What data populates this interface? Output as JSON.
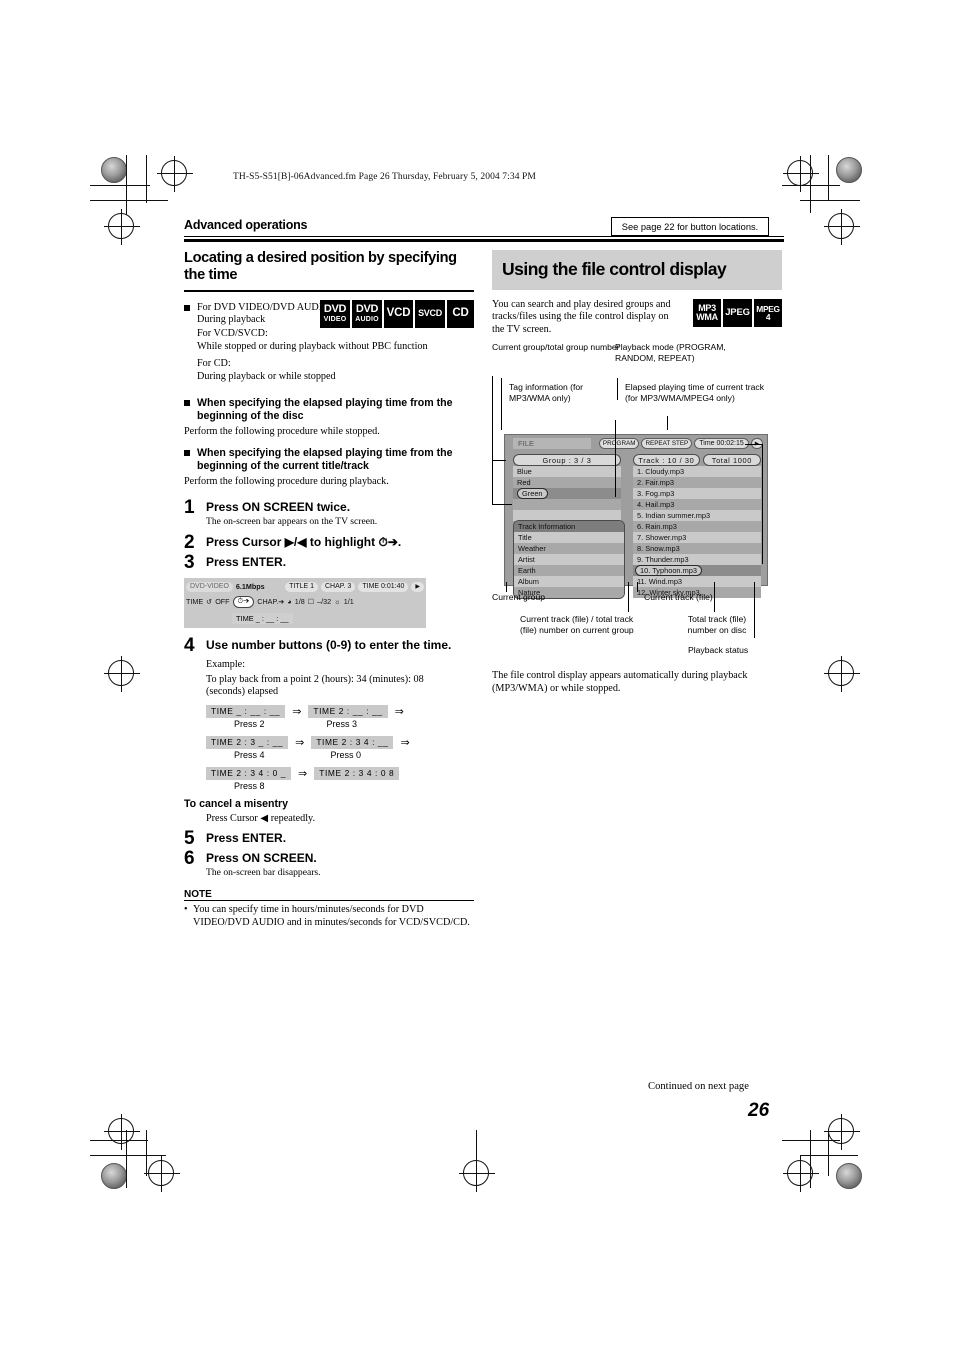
{
  "printmarks": {
    "present": true
  },
  "header": {
    "file_line": "TH-S5-S51[B]-06Advanced.fm  Page 26  Thursday, February 5, 2004  7:34 PM",
    "running_head": "Advanced operations",
    "see_page_note": "See page 22 for button locations."
  },
  "left_column": {
    "section_title": "Locating a desired position by specifying the time",
    "applicability": {
      "lines": [
        "For DVD VIDEO/DVD AUDIO:",
        "During playback",
        "For VCD/SVCD:",
        "While stopped or during playback without PBC function",
        "For CD:",
        "During playback or while stopped"
      ],
      "badges": [
        {
          "line1": "DVD",
          "line2": "VIDEO"
        },
        {
          "line1": "DVD",
          "line2": "AUDIO"
        },
        {
          "line1": "VCD",
          "line2": ""
        },
        {
          "line1": "SVCD",
          "line2": ""
        },
        {
          "line1": "CD",
          "line2": ""
        }
      ]
    },
    "bullets": [
      {
        "heading": "When specifying the elapsed playing time from the beginning of the disc",
        "text": "Perform the following procedure while stopped."
      },
      {
        "heading": "When specifying the elapsed playing time from the beginning of the current title/track",
        "text": "Perform the following procedure during playback."
      }
    ],
    "steps": [
      {
        "num": "1",
        "label": "Press ON SCREEN twice.",
        "sub": "The on-screen bar appears on the TV screen."
      },
      {
        "num": "2",
        "label": "Press Cursor ▶/◀ to highlight ⏱➔.",
        "sub": ""
      },
      {
        "num": "3",
        "label": "Press ENTER.",
        "sub": ""
      },
      {
        "num": "4",
        "label": "Use number buttons (0-9) to enter the time.",
        "sub": ""
      },
      {
        "num": "5",
        "label": "Press ENTER.",
        "sub": ""
      },
      {
        "num": "6",
        "label": "Press ON SCREEN.",
        "sub": "The on-screen bar disappears."
      }
    ],
    "onscreen_bar": {
      "row1": {
        "disc_type": "DVD-VIDEO",
        "bitrate": "6.1Mbps",
        "title": "TITLE 1",
        "chapter": "CHAP. 3",
        "time": "TIME  0:01:40",
        "play_icon": "▶"
      },
      "row2": {
        "time_label": "TIME",
        "repeat": "OFF",
        "time_search": "⏱➔",
        "chapter_search": "CHAP.➔",
        "audio": "1/8",
        "subtitle": "–/32",
        "angle": "1/1"
      },
      "row3": {
        "entry": "TIME   _ : __ : __"
      }
    },
    "example": {
      "label": "Example:",
      "text": "To play back from a point 2 (hours): 34 (minutes): 08 (seconds) elapsed",
      "rows": [
        {
          "before": "TIME   _ : __ : __",
          "press_before": "Press 2",
          "after": "TIME   2 : __ : __",
          "press_after": "Press 3"
        },
        {
          "before": "TIME   2 : 3 _ : __",
          "press_before": "Press 4",
          "after": "TIME   2 : 3 4 : __",
          "press_after": "Press 0"
        },
        {
          "before": "TIME   2 : 3 4 : 0 _",
          "press_before": "Press 8",
          "after": "TIME   2 : 3 4 : 0 8",
          "press_after": ""
        }
      ]
    },
    "cancel": {
      "heading": "To cancel a misentry",
      "text": "Press Cursor ◀ repeatedly."
    },
    "note": {
      "heading": "NOTE",
      "items": [
        "You can specify time in hours/minutes/seconds for DVD VIDEO/DVD AUDIO and in minutes/seconds for VCD/SVCD/CD."
      ]
    }
  },
  "right_column": {
    "section_title": "Using the file control display",
    "intro": "You can search and play desired groups and tracks/files using the file control display on the TV screen.",
    "badges": [
      {
        "line1": "MP3",
        "line2": "WMA"
      },
      {
        "line1": "JPEG",
        "line2": ""
      },
      {
        "line1": "MPEG",
        "line2": "4"
      }
    ],
    "callouts": {
      "top_left": "Current group/total group number",
      "top_right": "Playback mode (PROGRAM, RANDOM, REPEAT)",
      "mid_left": "Tag information (for MP3/WMA only)",
      "mid_right": "Elapsed playing time of current track (for MP3/WMA/MPEG4 only)",
      "bot_left": "Current group",
      "bot_mid": "Current track (file)",
      "bot_left2": "Current track (file) / total track (file) number on current group",
      "bot_right2": "Total track (file) number on disc",
      "bot_right3": "Playback status"
    },
    "file_display": {
      "file_label": "FILE",
      "status_chips": [
        "PROGRAM",
        "REPEAT STEP",
        "Time 00:02:15"
      ],
      "play_icon": "▶",
      "group_header": "Group :  3 / 3",
      "groups": [
        "Blue",
        "Red",
        "Green",
        "",
        ""
      ],
      "selected_group": "Green",
      "track_header": "Track : 10 / 30",
      "total_header": "Total  1000",
      "tracks": [
        "1. Cloudy.mp3",
        "2. Fair.mp3",
        "3. Fog.mp3",
        "4. Hail.mp3",
        "5. Indian summer.mp3",
        "6. Rain.mp3",
        "7. Shower.mp3",
        "8. Snow.mp3",
        "9. Thunder.mp3",
        "10. Typhoon.mp3",
        "11. Wind.mp3",
        "12. Winter sky.mp3"
      ],
      "selected_track": "10. Typhoon.mp3",
      "track_information": {
        "header": "Track  Information",
        "rows": [
          {
            "key": "Title",
            "value": "Weather"
          },
          {
            "key": "Artist",
            "value": "Earth"
          },
          {
            "key": "Album",
            "value": "Nature"
          }
        ]
      }
    },
    "outro": "The file control display appears automatically during playback (MP3/WMA) or while stopped."
  },
  "footer": {
    "continued": "Continued on next page",
    "page_number": "26"
  }
}
